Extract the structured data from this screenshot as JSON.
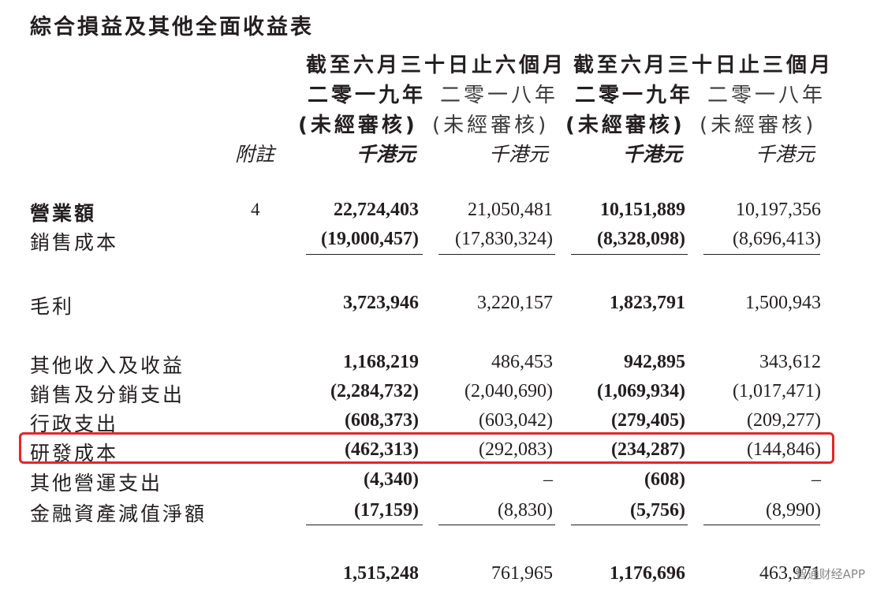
{
  "title": "綜合損益及其他全面收益表",
  "headers": {
    "six_months": "截至六月三十日止六個月",
    "three_months": "截至六月三十日止三個月",
    "year_2019": "二零一九年",
    "year_2018": "二零一八年",
    "unaudited": "(未經審核)",
    "note": "附註",
    "unit": "千港元"
  },
  "rows": [
    {
      "label": "營業額",
      "note": "4",
      "v1": "22,724,403",
      "v2": "21,050,481",
      "v3": "10,151,889",
      "v4": "10,197,356"
    },
    {
      "label": "銷售成本",
      "note": "",
      "v1": "(19,000,457)",
      "v2": "(17,830,324)",
      "v3": "(8,328,098)",
      "v4": "(8,696,413)"
    },
    {
      "label": "毛利",
      "note": "",
      "v1": "3,723,946",
      "v2": "3,220,157",
      "v3": "1,823,791",
      "v4": "1,500,943"
    },
    {
      "label": "其他收入及收益",
      "note": "",
      "v1": "1,168,219",
      "v2": "486,453",
      "v3": "942,895",
      "v4": "343,612"
    },
    {
      "label": "銷售及分銷支出",
      "note": "",
      "v1": "(2,284,732)",
      "v2": "(2,040,690)",
      "v3": "(1,069,934)",
      "v4": "(1,017,471)"
    },
    {
      "label": "行政支出",
      "note": "",
      "v1": "(608,373)",
      "v2": "(603,042)",
      "v3": "(279,405)",
      "v4": "(209,277)"
    },
    {
      "label": "研發成本",
      "note": "",
      "v1": "(462,313)",
      "v2": "(292,083)",
      "v3": "(234,287)",
      "v4": "(144,846)"
    },
    {
      "label": "其他營運支出",
      "note": "",
      "v1": "(4,340)",
      "v2": "–",
      "v3": "(608)",
      "v4": "–"
    },
    {
      "label": "金融資產減值淨額",
      "note": "",
      "v1": "(17,159)",
      "v2": "(8,830)",
      "v3": "(5,756)",
      "v4": "(8,990)"
    },
    {
      "label": "",
      "note": "",
      "v1": "1,515,248",
      "v2": "761,965",
      "v3": "1,176,696",
      "v4": "463,971"
    }
  ],
  "watermark": "智通财经APP",
  "highlight_color": "#e3262b"
}
